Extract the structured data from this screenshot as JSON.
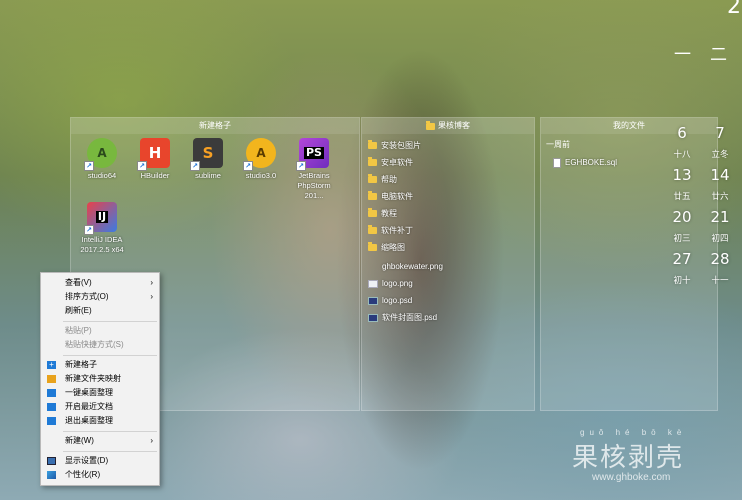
{
  "clock": {
    "top_right_partial": "2",
    "top_right_row": [
      "一",
      "二"
    ]
  },
  "panels": {
    "new_grid": {
      "title": "新建格子",
      "icons": [
        {
          "label": "studio64",
          "icon": "android-studio-icon"
        },
        {
          "label": "HBuilder",
          "icon": "hbuilder-icon"
        },
        {
          "label": "sublime",
          "icon": "sublime-icon"
        },
        {
          "label": "studio3.0",
          "icon": "android-studio-icon"
        },
        {
          "label": "JetBrains PhpStorm 201...",
          "icon": "phpstorm-icon"
        },
        {
          "label": "IntelliJ IDEA 2017.2.5 x64",
          "icon": "intellij-icon"
        }
      ]
    },
    "guohe": {
      "title": "果核博客",
      "items": [
        {
          "label": "安装包图片",
          "type": "folder"
        },
        {
          "label": "安卓软件",
          "type": "folder"
        },
        {
          "label": "帮助",
          "type": "folder"
        },
        {
          "label": "电脑软件",
          "type": "folder"
        },
        {
          "label": "教程",
          "type": "folder"
        },
        {
          "label": "软件补丁",
          "type": "folder"
        },
        {
          "label": "缩略图",
          "type": "folder"
        },
        {
          "label": "ghbokewater.png",
          "type": "image"
        },
        {
          "label": "logo.png",
          "type": "image"
        },
        {
          "label": "logo.psd",
          "type": "psd"
        },
        {
          "label": "软件封面图.psd",
          "type": "psd"
        }
      ]
    },
    "my_files": {
      "title": "我的文件",
      "section": "一周前",
      "files": [
        {
          "label": "EGHBOKE.sql"
        }
      ]
    }
  },
  "calendar": {
    "days": [
      {
        "num": "6",
        "lunar": "十八"
      },
      {
        "num": "7",
        "lunar": "立冬"
      },
      {
        "num": "13",
        "lunar": "廿五"
      },
      {
        "num": "14",
        "lunar": "廿六"
      },
      {
        "num": "20",
        "lunar": "初三"
      },
      {
        "num": "21",
        "lunar": "初四"
      },
      {
        "num": "27",
        "lunar": "初十"
      },
      {
        "num": "28",
        "lunar": "十一"
      }
    ]
  },
  "context_menu": {
    "items": [
      {
        "label": "查看(V)",
        "submenu": true
      },
      {
        "label": "排序方式(O)",
        "submenu": true
      },
      {
        "label": "刷新(E)"
      },
      {
        "label": "粘贴(P)",
        "disabled": true
      },
      {
        "label": "粘贴快捷方式(S)",
        "disabled": true
      },
      {
        "label": "新建格子",
        "icon": "plus-icon"
      },
      {
        "label": "新建文件夹映射",
        "icon": "folder-map-icon"
      },
      {
        "label": "一键桌面整理",
        "icon": "organize-icon"
      },
      {
        "label": "开启最近文档",
        "icon": "recent-docs-icon"
      },
      {
        "label": "退出桌面整理",
        "icon": "exit-icon"
      },
      {
        "label": "新建(W)",
        "submenu": true
      },
      {
        "label": "显示设置(D)",
        "icon": "display-icon"
      },
      {
        "label": "个性化(R)",
        "icon": "personalize-icon"
      }
    ]
  },
  "watermark": {
    "pinyin": "guǒ hé bō kè",
    "chars": "果核剥壳",
    "url": "www.ghboke.com"
  },
  "colors": {
    "menu_bg": "#f2f2f2",
    "menu_icon_blue": "#1f7ad6",
    "menu_icon_orange": "#e8a21c",
    "folder": "#f2c744"
  }
}
